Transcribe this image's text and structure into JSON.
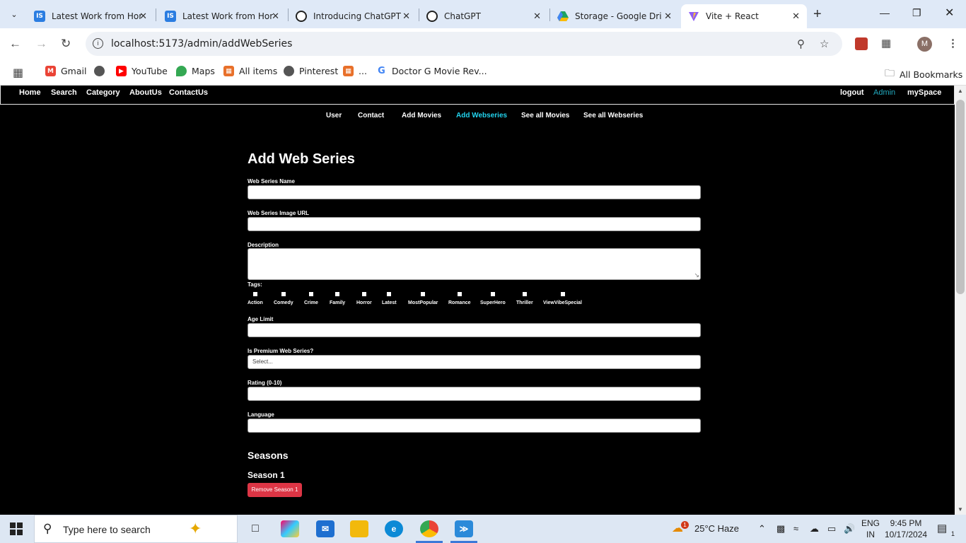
{
  "browser": {
    "tabs": [
      {
        "title": "Latest Work from Hor",
        "favicon": "IS",
        "color": "#2b7de1",
        "active": false
      },
      {
        "title": "Latest Work from Hor",
        "favicon": "IS",
        "color": "#2b7de1",
        "active": false
      },
      {
        "title": "Introducing ChatGPT",
        "favicon": "openai-icon",
        "color": "#222222",
        "active": false
      },
      {
        "title": "ChatGPT",
        "favicon": "openai-icon",
        "color": "#222222",
        "active": false
      },
      {
        "title": "Storage - Google Dri",
        "favicon": "google-drive-icon",
        "color": "#1ea362",
        "active": false
      },
      {
        "title": "Vite + React",
        "favicon": "vite-icon",
        "color": "#8e5cf5",
        "active": true
      }
    ],
    "url": "localhost:5173/admin/addWebSeries",
    "profile_initial": "M",
    "bookmarks": [
      {
        "label": "Gmail",
        "icon": "gmail-icon",
        "color": "#ea4335"
      },
      {
        "label": "",
        "icon": "globe-icon",
        "color": "#555555"
      },
      {
        "label": "YouTube",
        "icon": "youtube-icon",
        "color": "#ff0000"
      },
      {
        "label": "Maps",
        "icon": "maps-icon",
        "color": "#34a853"
      },
      {
        "label": "All items",
        "icon": "box-icon",
        "color": "#e8702a"
      },
      {
        "label": "Pinterest",
        "icon": "globe-icon",
        "color": "#555555"
      },
      {
        "label": "...",
        "icon": "box-icon",
        "color": "#e8702a"
      },
      {
        "label": "Doctor G Movie Rev...",
        "icon": "google-icon",
        "color": "#4285f4"
      }
    ],
    "all_bookmarks": "All Bookmarks"
  },
  "site": {
    "topnav_left": [
      "Home",
      "Search",
      "Category",
      "AboutUs",
      "ContactUs"
    ],
    "topnav_right": [
      "logout",
      "Admin",
      "mySpace"
    ],
    "subnav": [
      "User",
      "Contact",
      "Add Movies",
      "Add Webseries",
      "See all Movies",
      "See all Webseries"
    ],
    "accent": "#22d3ee"
  },
  "form": {
    "title": "Add Web Series",
    "name_label": "Web Series Name",
    "image_label": "Web Series Image URL",
    "description_label": "Description",
    "tags_label": "Tags:",
    "tags": [
      "Action",
      "Comedy",
      "Crime",
      "Family",
      "Horror",
      "Latest",
      "MostPopular",
      "Romance",
      "SuperHero",
      "Thriller",
      "ViewVibeSpecial"
    ],
    "age_label": "Age Limit",
    "premium_label": "Is Premium Web Series?",
    "premium_placeholder": "Select...",
    "rating_label": "Rating (0-10)",
    "language_label": "Language",
    "seasons_title": "Seasons",
    "season_title": "Season 1",
    "remove_season": "Remove Season 1",
    "danger_color": "#dc3545"
  },
  "taskbar": {
    "search_placeholder": "Type here to search",
    "weather": "25°C  Haze",
    "weather_badge": "1",
    "lang_top": "ENG",
    "lang_bottom": "IN",
    "time": "9:45 PM",
    "date": "10/17/2024",
    "notification_count": "1"
  }
}
